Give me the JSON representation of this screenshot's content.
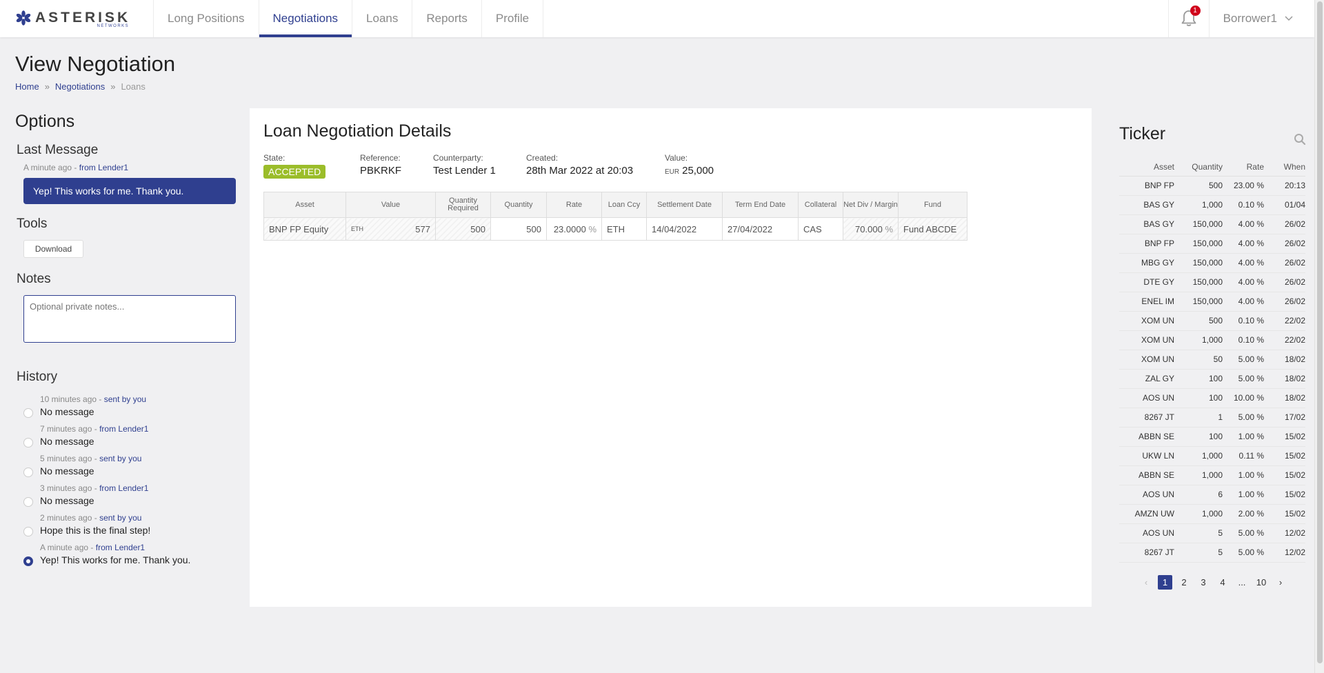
{
  "nav": {
    "logo_text": "ASTERISK",
    "logo_sub": "NETWORKS",
    "tabs": [
      {
        "label": "Long Positions"
      },
      {
        "label": "Negotiations"
      },
      {
        "label": "Loans"
      },
      {
        "label": "Reports"
      },
      {
        "label": "Profile"
      }
    ],
    "notification_count": "1",
    "user": "Borrower1"
  },
  "page": {
    "title": "View Negotiation",
    "breadcrumb": [
      "Home",
      "Negotiations",
      "Loans"
    ]
  },
  "options": {
    "title": "Options",
    "last_message": {
      "heading": "Last Message",
      "time": "A minute ago",
      "who": "from Lender1",
      "text": "Yep! This works for me. Thank you."
    },
    "tools": {
      "heading": "Tools",
      "download_label": "Download"
    },
    "notes": {
      "heading": "Notes",
      "placeholder": "Optional private notes..."
    },
    "history": {
      "heading": "History",
      "items": [
        {
          "time": "10 minutes ago",
          "who": "sent by you",
          "msg": "No message"
        },
        {
          "time": "7 minutes ago",
          "who": "from Lender1",
          "msg": "No message"
        },
        {
          "time": "5 minutes ago",
          "who": "sent by you",
          "msg": "No message"
        },
        {
          "time": "3 minutes ago",
          "who": "from Lender1",
          "msg": "No message"
        },
        {
          "time": "2 minutes ago",
          "who": "sent by you",
          "msg": "Hope this is the final step!"
        },
        {
          "time": "A minute ago",
          "who": "from Lender1",
          "msg": "Yep! This works for me. Thank you."
        }
      ]
    }
  },
  "details": {
    "title": "Loan Negotiation Details",
    "state_label": "State:",
    "state": "ACCEPTED",
    "reference_label": "Reference:",
    "reference": "PBKRKF",
    "counterparty_label": "Counterparty:",
    "counterparty": "Test Lender 1",
    "created_label": "Created:",
    "created": "28th Mar 2022 at 20:03",
    "value_label": "Value:",
    "value_currency": "EUR",
    "value": "25,000",
    "columns": [
      "Asset",
      "Value",
      "Quantity Required",
      "Quantity",
      "Rate",
      "Loan Ccy",
      "Settlement Date",
      "Term End Date",
      "Collateral",
      "Net Div / Margin",
      "Fund"
    ],
    "row": {
      "asset": "BNP FP Equity",
      "value_unit": "ETH",
      "value": "577",
      "qty_required": "500",
      "quantity": "500",
      "rate": "23.0000",
      "rate_unit": "%",
      "loan_ccy": "ETH",
      "settlement_date": "14/04/2022",
      "term_end_date": "27/04/2022",
      "collateral": "CAS",
      "net_div": "70.000",
      "net_div_unit": "%",
      "fund": "Fund ABCDE"
    }
  },
  "ticker": {
    "title": "Ticker",
    "columns": [
      "Asset",
      "Quantity",
      "Rate",
      "When"
    ],
    "rows": [
      [
        "BNP FP",
        "500",
        "23.00 %",
        "20:13"
      ],
      [
        "BAS GY",
        "1,000",
        "0.10 %",
        "01/04"
      ],
      [
        "BAS GY",
        "150,000",
        "4.00 %",
        "26/02"
      ],
      [
        "BNP FP",
        "150,000",
        "4.00 %",
        "26/02"
      ],
      [
        "MBG GY",
        "150,000",
        "4.00 %",
        "26/02"
      ],
      [
        "DTE GY",
        "150,000",
        "4.00 %",
        "26/02"
      ],
      [
        "ENEL IM",
        "150,000",
        "4.00 %",
        "26/02"
      ],
      [
        "XOM UN",
        "500",
        "0.10 %",
        "22/02"
      ],
      [
        "XOM UN",
        "1,000",
        "0.10 %",
        "22/02"
      ],
      [
        "XOM UN",
        "50",
        "5.00 %",
        "18/02"
      ],
      [
        "ZAL GY",
        "100",
        "5.00 %",
        "18/02"
      ],
      [
        "AOS UN",
        "100",
        "10.00 %",
        "18/02"
      ],
      [
        "8267 JT",
        "1",
        "5.00 %",
        "17/02"
      ],
      [
        "ABBN SE",
        "100",
        "1.00 %",
        "15/02"
      ],
      [
        "UKW LN",
        "1,000",
        "0.11 %",
        "15/02"
      ],
      [
        "ABBN SE",
        "1,000",
        "1.00 %",
        "15/02"
      ],
      [
        "AOS UN",
        "6",
        "1.00 %",
        "15/02"
      ],
      [
        "AMZN UW",
        "1,000",
        "2.00 %",
        "15/02"
      ],
      [
        "AOS UN",
        "5",
        "5.00 %",
        "12/02"
      ],
      [
        "8267 JT",
        "5",
        "5.00 %",
        "12/02"
      ]
    ],
    "pager": [
      "1",
      "2",
      "3",
      "4",
      "...",
      "10"
    ]
  }
}
